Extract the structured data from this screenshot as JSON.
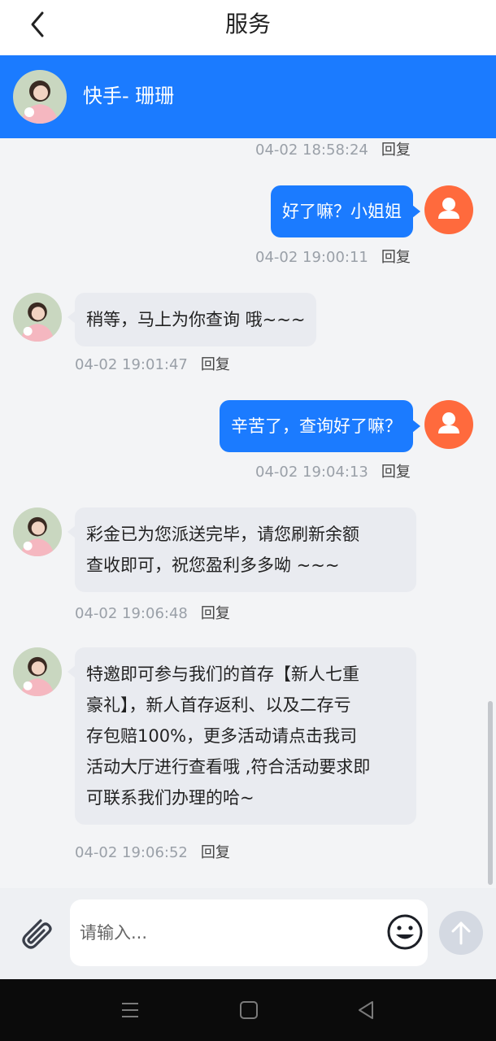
{
  "header": {
    "title": "服务"
  },
  "agent": {
    "name": "快手- 珊珊"
  },
  "messages": [
    {
      "dir": "in",
      "text": "",
      "time": "04-02 18:58:24",
      "reply": "回复"
    },
    {
      "dir": "out",
      "text": "好了嘛？小姐姐",
      "time": "04-02 19:00:11",
      "reply": "回复"
    },
    {
      "dir": "in",
      "text": "稍等，马上为你查询 哦~~~",
      "time": "04-02 19:01:47",
      "reply": "回复"
    },
    {
      "dir": "out",
      "text": "辛苦了，查询好了嘛？",
      "time": "04-02 19:04:13",
      "reply": "回复"
    },
    {
      "dir": "in",
      "lines": [
        "彩金已为您派送完毕，请您刷新余额",
        "查收即可，祝您盈利多多呦 ~~~"
      ],
      "time": "04-02 19:06:48",
      "reply": "回复"
    },
    {
      "dir": "in",
      "lines": [
        "特邀即可参与我们的首存【新人七重",
        "豪礼】，新人首存返利、以及二存亏",
        "存包赔100%，更多活动请点击我司",
        "活动大厅进行查看哦 ,符合活动要求即",
        "可联系我们办理的哈~"
      ],
      "time": "04-02 19:06:52",
      "reply": "回复"
    }
  ],
  "input": {
    "placeholder": "请输入..."
  },
  "icons": {
    "back": "chevron-left-icon",
    "attach": "paperclip-icon",
    "emoji": "smiley-icon",
    "send": "arrow-up-icon",
    "user": "user-icon"
  },
  "colors": {
    "accent": "#1b7bff",
    "user_avatar": "#ff6a3d",
    "incoming_bubble": "#e9ebf0"
  }
}
